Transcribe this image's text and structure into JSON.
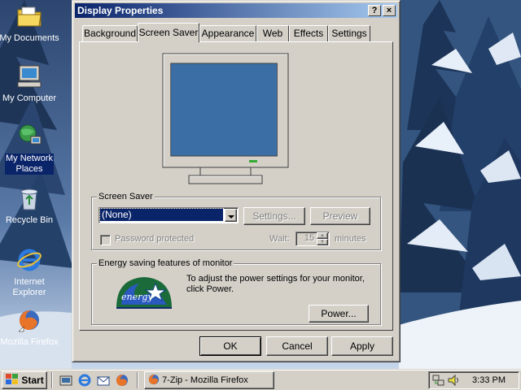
{
  "desktop": {
    "icons": [
      {
        "name": "my-documents",
        "label": "My Documents"
      },
      {
        "name": "my-computer",
        "label": "My Computer"
      },
      {
        "name": "my-network-places",
        "label_line1": "My Network",
        "label_line2": "Places"
      },
      {
        "name": "recycle-bin",
        "label": "Recycle Bin"
      },
      {
        "name": "internet-explorer",
        "label_line1": "Internet",
        "label_line2": "Explorer"
      },
      {
        "name": "mozilla-firefox",
        "label": "Mozilla Firefox"
      }
    ]
  },
  "window": {
    "title": "Display Properties",
    "help_button": "?",
    "close_button": "×",
    "tabs": [
      "Background",
      "Screen Saver",
      "Appearance",
      "Web",
      "Effects",
      "Settings"
    ],
    "active_tab": "Screen Saver",
    "screen_saver": {
      "group_title": "Screen Saver",
      "selected": "(None)",
      "settings_button": "Settings...",
      "preview_button": "Preview",
      "password_label": "Password protected",
      "password_checked": false,
      "wait_label": "Wait:",
      "wait_value": "15",
      "minutes_label": "minutes"
    },
    "energy": {
      "group_title": "Energy saving features of monitor",
      "logo_text": "energy",
      "text": "To adjust the power settings for your monitor, click Power.",
      "power_button": "Power..."
    },
    "ok_button": "OK",
    "cancel_button": "Cancel",
    "apply_button": "Apply"
  },
  "taskbar": {
    "start_label": "Start",
    "quick_launch": [
      "show-desktop-icon",
      "internet-explorer-icon",
      "outlook-icon",
      "firefox-icon"
    ],
    "task": "7-Zip - Mozilla Firefox",
    "clock": "3:33 PM"
  },
  "colors": {
    "titlebar_start": "#0a246a",
    "titlebar_end": "#a6caf0",
    "face": "#d4d0c8",
    "selection": "#0a246a",
    "monitor_screen": "#3a6ea5"
  }
}
